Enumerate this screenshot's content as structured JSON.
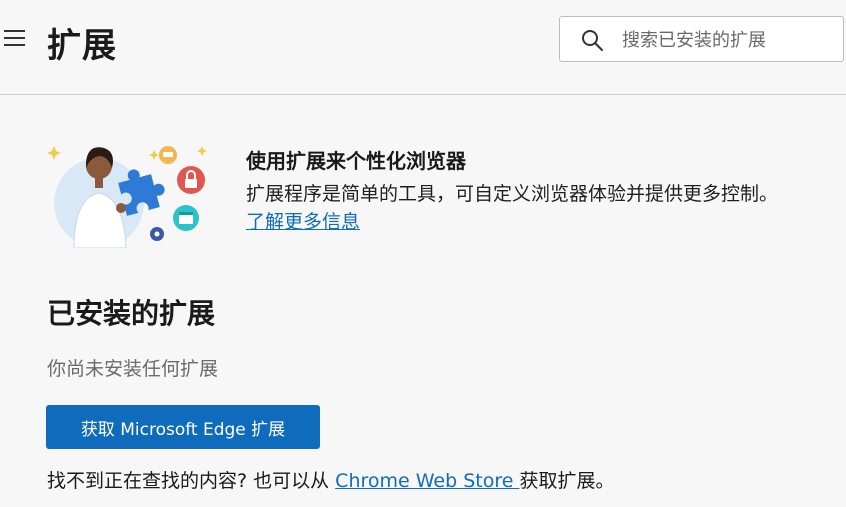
{
  "header": {
    "title": "扩展",
    "search_placeholder": "搜索已安装的扩展"
  },
  "hero": {
    "title": "使用扩展来个性化浏览器",
    "description": "扩展程序是简单的工具，可自定义浏览器体验并提供更多控制。",
    "learn_more_link": "了解更多信息"
  },
  "installed": {
    "title": "已安装的扩展",
    "empty_message": "你尚未安装任何扩展",
    "get_button": "获取 Microsoft Edge 扩展"
  },
  "footer_hint": {
    "prefix": "找不到正在查找的内容? 也可以从 ",
    "link": "Chrome Web Store ",
    "suffix": "获取扩展。"
  },
  "colors": {
    "accent": "#0f6cbd",
    "background": "#f7f7f7"
  },
  "icons": [
    "menu-icon",
    "search-icon",
    "puzzle-icon",
    "lock-icon",
    "calendar-icon",
    "cart-icon",
    "gear-icon"
  ]
}
